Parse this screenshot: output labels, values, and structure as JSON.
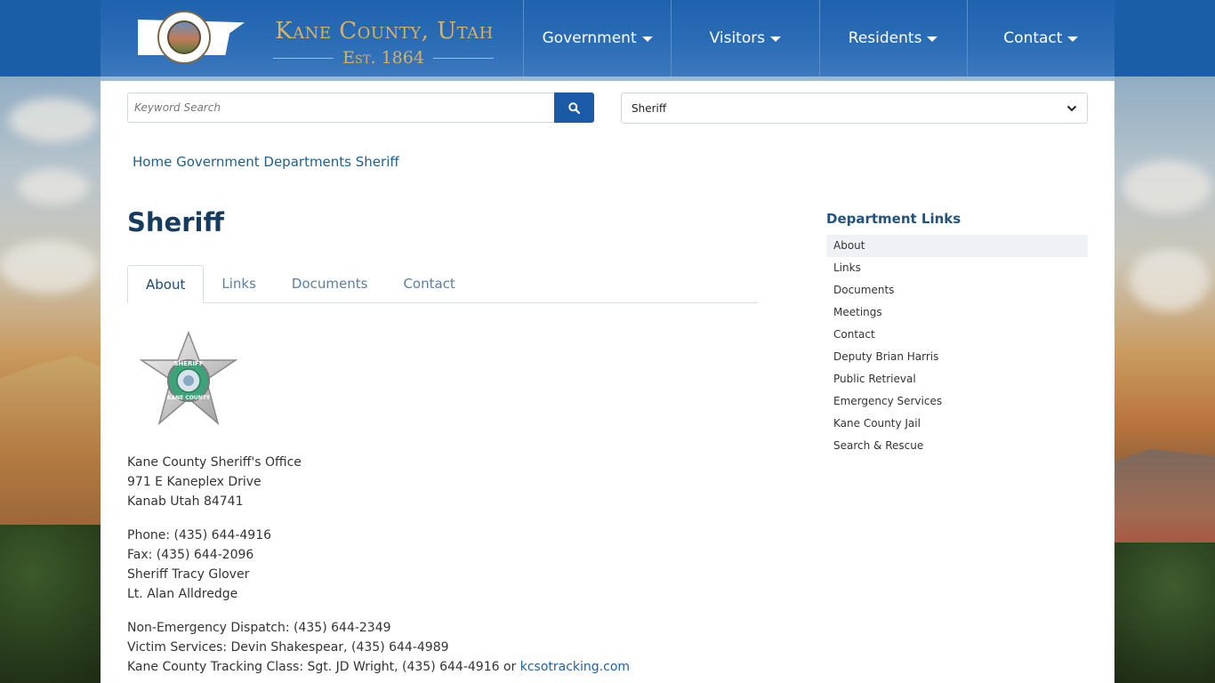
{
  "site": {
    "title": "Kane County, Utah",
    "established": "Est. 1864"
  },
  "nav": {
    "items": [
      {
        "label": "Government"
      },
      {
        "label": "Visitors"
      },
      {
        "label": "Residents"
      },
      {
        "label": "Contact"
      }
    ]
  },
  "search": {
    "placeholder": "Keyword Search",
    "button_icon": "search-icon"
  },
  "department_select": {
    "selected": "Sheriff"
  },
  "breadcrumb": [
    "Home",
    "Government",
    "Departments",
    "Sheriff"
  ],
  "page": {
    "title": "Sheriff",
    "tabs": [
      {
        "label": "About",
        "active": true
      },
      {
        "label": "Links"
      },
      {
        "label": "Documents"
      },
      {
        "label": "Contact"
      }
    ],
    "badge": {
      "top_text": "SHERIFF",
      "bottom_text": "KANE COUNTY"
    },
    "address": [
      "Kane County Sheriff's Office",
      "971 E Kaneplex Drive",
      "Kanab Utah 84741"
    ],
    "contacts": [
      "Phone: (435) 644-4916",
      "Fax: (435) 644-2096",
      "Sheriff Tracy Glover",
      "Lt. Alan Alldredge"
    ],
    "services": {
      "dispatch": "Non-Emergency Dispatch: (435) 644-2349",
      "victim": "Victim Services: Devin Shakespear, (435) 644-4989",
      "tracking_prefix": "Kane County Tracking Class: Sgt. JD Wright, (435) 644-4916 or",
      "tracking_link": "kcsotracking.com"
    }
  },
  "sidebar": {
    "title": "Department Links",
    "links": [
      {
        "label": "About",
        "active": true
      },
      {
        "label": "Links"
      },
      {
        "label": "Documents"
      },
      {
        "label": "Meetings"
      },
      {
        "label": "Contact"
      },
      {
        "label": "Deputy Brian Harris"
      },
      {
        "label": "Public Retrieval"
      },
      {
        "label": "Emergency Services"
      },
      {
        "label": "Kane County Jail"
      },
      {
        "label": "Search & Rescue"
      }
    ]
  },
  "colors": {
    "header_blue": "#1f62ad",
    "accent_gold": "#d6b264",
    "link_blue": "#1e5f8f",
    "button_blue": "#1a5aa6"
  }
}
